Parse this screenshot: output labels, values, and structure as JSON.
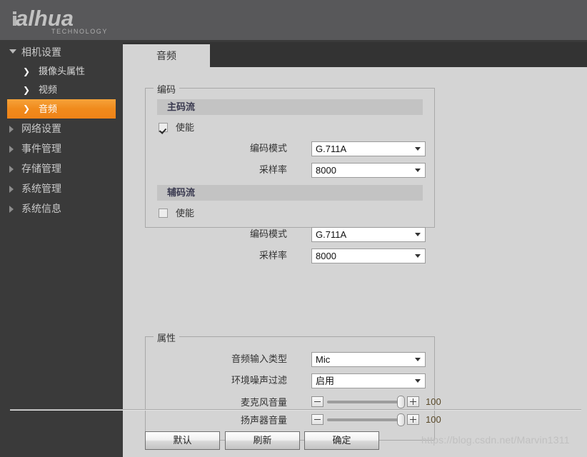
{
  "header": {
    "brand": "alhua",
    "brand_sub": "TECHNOLOGY"
  },
  "sidebar": {
    "groups": [
      {
        "label": "相机设置",
        "icon": "triangle-down-icon",
        "expanded": true,
        "children": [
          {
            "label": "摄像头属性",
            "icon": "chevron-right-icon",
            "active": false
          },
          {
            "label": "视频",
            "icon": "chevron-right-icon",
            "active": false
          },
          {
            "label": "音频",
            "icon": "chevron-right-icon",
            "active": true
          }
        ]
      },
      {
        "label": "网络设置",
        "icon": "triangle-right-icon",
        "expanded": false,
        "children": []
      },
      {
        "label": "事件管理",
        "icon": "triangle-right-icon",
        "expanded": false,
        "children": []
      },
      {
        "label": "存储管理",
        "icon": "triangle-right-icon",
        "expanded": false,
        "children": []
      },
      {
        "label": "系统管理",
        "icon": "triangle-right-icon",
        "expanded": false,
        "children": []
      },
      {
        "label": "系统信息",
        "icon": "triangle-right-icon",
        "expanded": false,
        "children": []
      }
    ]
  },
  "tabs": [
    {
      "label": "音频",
      "active": true
    }
  ],
  "encoding": {
    "legend": "编码",
    "main_stream": {
      "section_title": "主码流",
      "enable_label": "使能",
      "enable_checked": true,
      "encode_mode_label": "编码模式",
      "encode_mode_value": "G.711A",
      "sample_rate_label": "采样率",
      "sample_rate_value": "8000"
    },
    "sub_stream": {
      "section_title": "辅码流",
      "enable_label": "使能",
      "enable_checked": false,
      "encode_mode_label": "编码模式",
      "encode_mode_value": "G.711A",
      "sample_rate_label": "采样率",
      "sample_rate_value": "8000"
    }
  },
  "attributes": {
    "legend": "属性",
    "audio_input_type_label": "音频输入类型",
    "audio_input_type_value": "Mic",
    "noise_filter_label": "环境噪声过滤",
    "noise_filter_value": "启用",
    "mic_volume_label": "麦克风音量",
    "mic_volume_value": "100",
    "speaker_volume_label": "扬声器音量",
    "speaker_volume_value": "100",
    "minus_icon": "minus-icon",
    "plus_icon": "plus-icon"
  },
  "footer": {
    "default_label": "默认",
    "refresh_label": "刷新",
    "confirm_label": "确定"
  },
  "watermark": "https://blog.csdn.net/Marvin1311",
  "colors": {
    "accent": "#ef8318",
    "header_bg": "#58585a",
    "sidebar_bg": "#3a3a3a",
    "panel_bg": "#d4d4d4",
    "tabbar_bg": "#333333"
  }
}
